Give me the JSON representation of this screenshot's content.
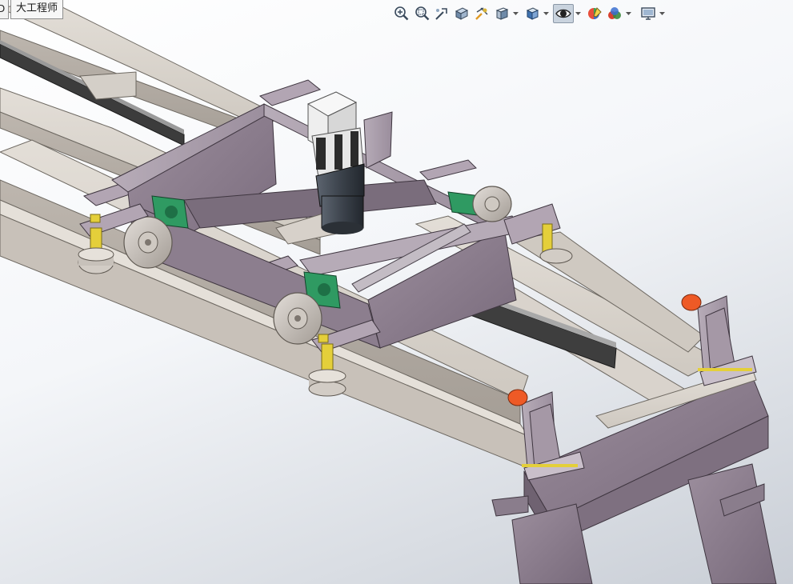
{
  "document_tabs": {
    "stub_label": "D",
    "active_label": "大工程师"
  },
  "heads_up_toolbar": {
    "items": [
      {
        "icon": "zoom-to-fit-icon",
        "dropdown": false
      },
      {
        "icon": "zoom-to-area-icon",
        "dropdown": false
      },
      {
        "icon": "previous-view-icon",
        "dropdown": false
      },
      {
        "icon": "section-view-icon",
        "dropdown": false
      },
      {
        "icon": "dynamic-annotation-icon",
        "dropdown": false
      },
      {
        "icon": "view-orientation-icon",
        "dropdown": true
      },
      {
        "icon": "display-style-icon",
        "dropdown": true
      },
      {
        "icon": "hide-show-items-icon",
        "dropdown": true,
        "active": true
      },
      {
        "icon": "edit-appearance-icon",
        "dropdown": false
      },
      {
        "icon": "apply-scene-icon",
        "dropdown": true
      },
      {
        "icon": "view-settings-icon",
        "dropdown": true
      }
    ]
  },
  "colors": {
    "background_top": "#ffffff",
    "background_bottom": "#c9ced6",
    "frame_steel": "#d6d0c8",
    "carriage_purple": "#8a7a8c",
    "bearing_green": "#2f9a62",
    "motor_white": "#eeeeee",
    "stop_orange": "#ee5a26",
    "bolt_yellow": "#e4cf3a"
  }
}
